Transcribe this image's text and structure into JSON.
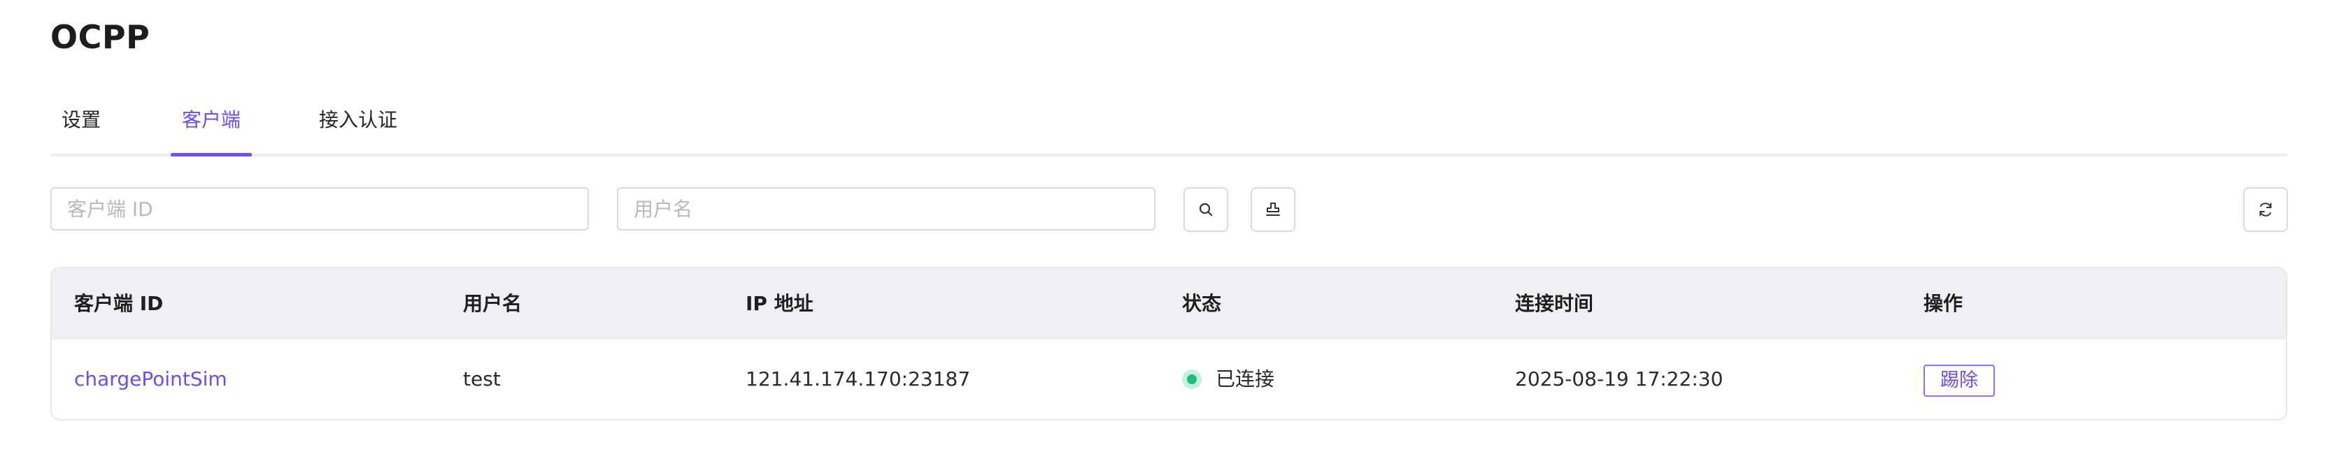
{
  "page": {
    "title": "OCPP"
  },
  "tabs": [
    {
      "label": "设置",
      "active": false
    },
    {
      "label": "客户端",
      "active": true
    },
    {
      "label": "接入认证",
      "active": false
    }
  ],
  "filters": {
    "client_id": {
      "placeholder": "客户端 ID",
      "value": ""
    },
    "username": {
      "placeholder": "用户名",
      "value": ""
    },
    "search_icon": "search-icon",
    "clear_icon": "clear-filter-icon",
    "refresh_icon": "refresh-icon"
  },
  "table": {
    "headers": [
      "客户端 ID",
      "用户名",
      "IP 地址",
      "状态",
      "连接时间",
      "操作"
    ],
    "rows": [
      {
        "client_id": "chargePointSim",
        "username": "test",
        "ip": "121.41.174.170:23187",
        "status": "已连接",
        "connected_at": "2025-08-19 17:22:30",
        "action": "踢除"
      }
    ]
  },
  "colors": {
    "accent": "#6d4bff",
    "status_connected": "#1fbf7a",
    "header_bg": "#eef0f4"
  }
}
